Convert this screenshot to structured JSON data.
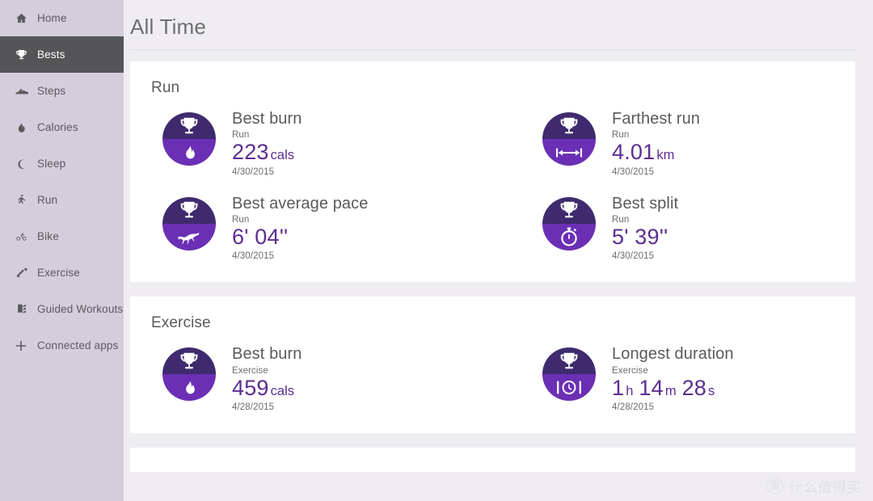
{
  "sidebar": {
    "items": [
      {
        "label": "Home",
        "icon": "home-icon",
        "selected": false
      },
      {
        "label": "Bests",
        "icon": "trophy-icon",
        "selected": true
      },
      {
        "label": "Steps",
        "icon": "shoe-icon",
        "selected": false
      },
      {
        "label": "Calories",
        "icon": "flame-icon",
        "selected": false
      },
      {
        "label": "Sleep",
        "icon": "moon-icon",
        "selected": false
      },
      {
        "label": "Run",
        "icon": "runner-icon",
        "selected": false
      },
      {
        "label": "Bike",
        "icon": "bike-icon",
        "selected": false
      },
      {
        "label": "Exercise",
        "icon": "dumbbell-icon",
        "selected": false
      },
      {
        "label": "Guided Workouts",
        "icon": "clipboard-icon",
        "selected": false
      },
      {
        "label": "Connected apps",
        "icon": "plus-icon",
        "selected": false
      }
    ]
  },
  "header": {
    "title": "All Time"
  },
  "colors": {
    "accent_purple": "#5c2d91",
    "badge_top": "#3f2a6e",
    "badge_bottom": "#6b2fb5",
    "sidebar_bg": "#d4cedc",
    "sidebar_selected_bg": "#555558",
    "page_bg": "#efedf2",
    "card_bg": "#ffffff"
  },
  "sections": [
    {
      "title": "Run",
      "stats": [
        {
          "label": "Best burn",
          "sub": "Run",
          "value": "223",
          "unit": "cals",
          "value2": "",
          "unit2": "",
          "value3": "",
          "unit3": "",
          "date": "4/30/2015",
          "badge_top_icon": "trophy-icon",
          "badge_bottom_icon": "flame-icon"
        },
        {
          "label": "Farthest run",
          "sub": "Run",
          "value": "4.01",
          "unit": "km",
          "value2": "",
          "unit2": "",
          "value3": "",
          "unit3": "",
          "date": "4/30/2015",
          "badge_top_icon": "trophy-icon",
          "badge_bottom_icon": "distance-icon"
        },
        {
          "label": "Best average pace",
          "sub": "Run",
          "value": "6' 04''",
          "unit": "",
          "value2": "",
          "unit2": "",
          "value3": "",
          "unit3": "",
          "date": "4/30/2015",
          "badge_top_icon": "trophy-icon",
          "badge_bottom_icon": "cheetah-icon"
        },
        {
          "label": "Best split",
          "sub": "Run",
          "value": "5' 39''",
          "unit": "",
          "value2": "",
          "unit2": "",
          "value3": "",
          "unit3": "",
          "date": "4/30/2015",
          "badge_top_icon": "trophy-icon",
          "badge_bottom_icon": "stopwatch-icon"
        }
      ]
    },
    {
      "title": "Exercise",
      "stats": [
        {
          "label": "Best burn",
          "sub": "Exercise",
          "value": "459",
          "unit": "cals",
          "value2": "",
          "unit2": "",
          "value3": "",
          "unit3": "",
          "date": "4/28/2015",
          "badge_top_icon": "trophy-icon",
          "badge_bottom_icon": "flame-icon"
        },
        {
          "label": "Longest duration",
          "sub": "Exercise",
          "value": "1",
          "unit": "h",
          "value2": "14",
          "unit2": "m",
          "value3": "28",
          "unit3": "s",
          "date": "4/28/2015",
          "badge_top_icon": "trophy-icon",
          "badge_bottom_icon": "duration-clock-icon"
        }
      ]
    }
  ],
  "watermark": {
    "logo": "值",
    "text": "什么值得买"
  }
}
